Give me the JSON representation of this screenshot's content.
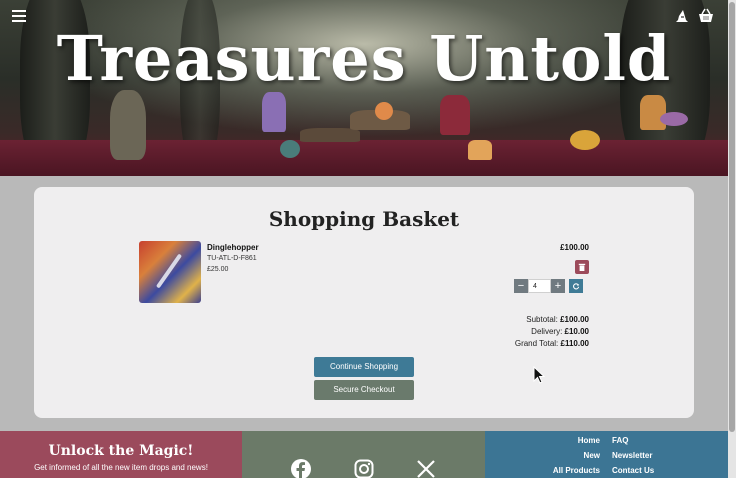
{
  "header": {
    "title": "Treasures Untold",
    "menu_icon": "hamburger-icon",
    "account_icon": "wizard-hat-icon",
    "basket_icon": "basket-icon"
  },
  "basket": {
    "heading": "Shopping Basket",
    "item": {
      "name": "Dinglehopper",
      "sku": "TU-ATL-D-F861",
      "unit_price": "£25.00",
      "line_total": "£100.00",
      "quantity": "4"
    },
    "totals": {
      "subtotal_label": "Subtotal:",
      "subtotal_value": "£100.00",
      "delivery_label": "Delivery:",
      "delivery_value": "£10.00",
      "grand_label": "Grand Total:",
      "grand_value": "£110.00"
    },
    "continue_label": "Continue Shopping",
    "checkout_label": "Secure Checkout"
  },
  "footer": {
    "newsletter_heading": "Unlock the Magic!",
    "newsletter_text": "Get informed of all the new item drops and news!",
    "social": [
      "facebook-icon",
      "instagram-icon",
      "x-icon"
    ],
    "links_left": [
      "Home",
      "New",
      "All Products"
    ],
    "links_right": [
      "FAQ",
      "Newsletter",
      "Contact Us"
    ]
  },
  "colors": {
    "accent_blue": "#3e7a96",
    "accent_green": "#6a7a6c",
    "accent_red": "#9b4a5c"
  }
}
